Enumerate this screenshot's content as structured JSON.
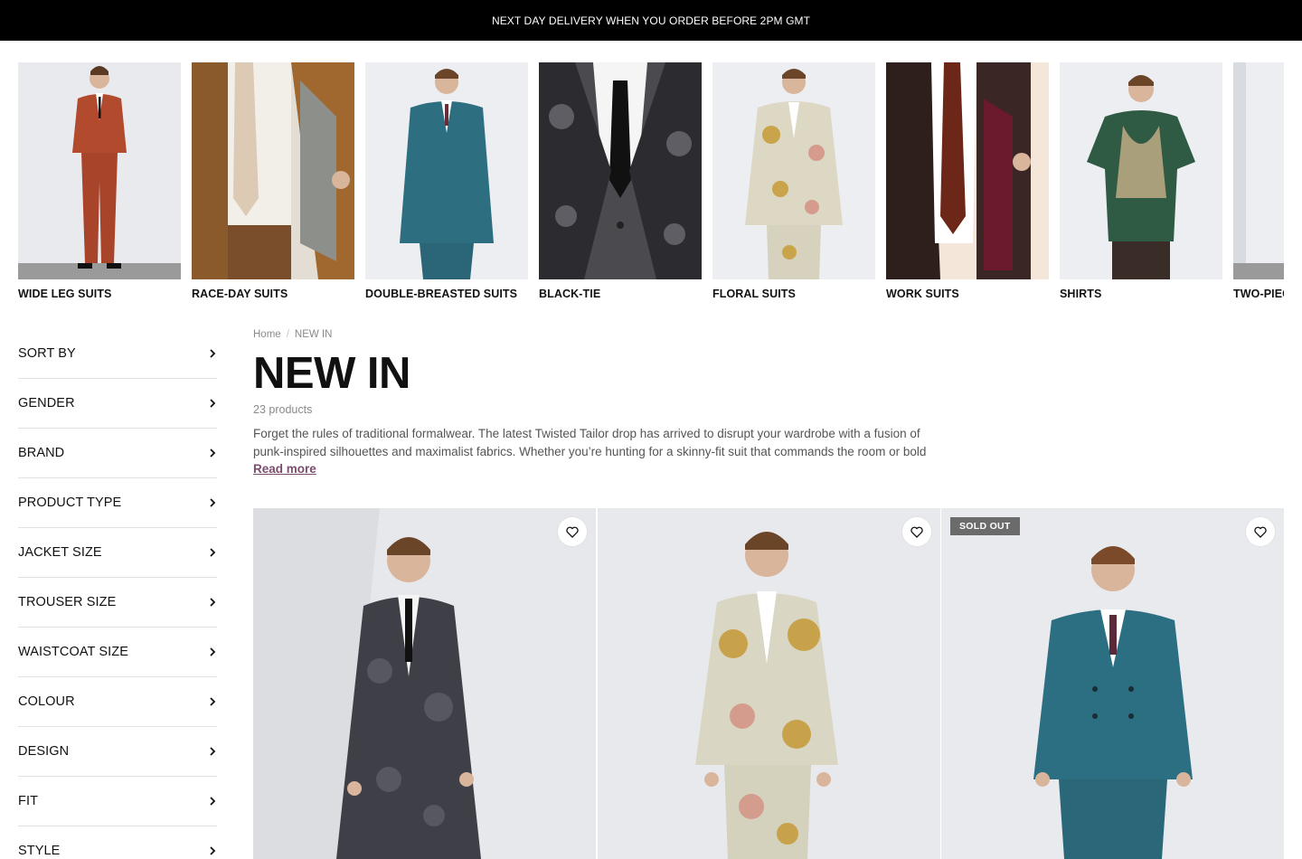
{
  "announcement": "NEXT DAY DELIVERY WHEN YOU ORDER BEFORE 2PM GMT",
  "categories": [
    {
      "label": "WIDE LEG SUITS",
      "bg": "#e9eaed",
      "suit": "#b24a2e"
    },
    {
      "label": "RACE-DAY SUITS",
      "bg": "#f1ece4",
      "suit": "#8b5a2b"
    },
    {
      "label": "DOUBLE-BREASTED SUITS",
      "bg": "#eceef1",
      "suit": "#2d6f80"
    },
    {
      "label": "BLACK-TIE",
      "bg": "#4a4a4f",
      "suit": "#333338"
    },
    {
      "label": "FLORAL SUITS",
      "bg": "#eceef1",
      "suit": "#d8d2b8"
    },
    {
      "label": "WORK SUITS",
      "bg": "#f5e6da",
      "suit": "#3a2624"
    },
    {
      "label": "SHIRTS",
      "bg": "#eceef1",
      "suit": "#2f5a43"
    },
    {
      "label": "TWO-PIECE",
      "bg": "#eceef1",
      "suit": "#888"
    }
  ],
  "filters": [
    "SORT BY",
    "GENDER",
    "BRAND",
    "PRODUCT TYPE",
    "JACKET SIZE",
    "TROUSER SIZE",
    "WAISTCOAT SIZE",
    "COLOUR",
    "DESIGN",
    "FIT",
    "STYLE"
  ],
  "breadcrumb": {
    "home": "Home",
    "current": "NEW IN"
  },
  "page_title": "NEW IN",
  "product_count": "23 products",
  "description": "Forget the rules of traditional formalwear. The latest Twisted Tailor drop has arrived to disrupt your wardrobe with a fusion of punk-inspired silhouettes and maximalist fabrics. Whether you’re hunting for a skinny-fit suit that commands the room or bold unisex",
  "read_more": "Read more",
  "products": [
    {
      "badge": "",
      "suit": "#3f4047"
    },
    {
      "badge": "",
      "suit": "#d9d6c3"
    },
    {
      "badge": "SOLD OUT",
      "suit": "#2c6f82"
    }
  ],
  "colors": {
    "accent": "#7a4c6e",
    "announcement_bg": "#000000",
    "badge_bg": "#6b6b6b"
  }
}
